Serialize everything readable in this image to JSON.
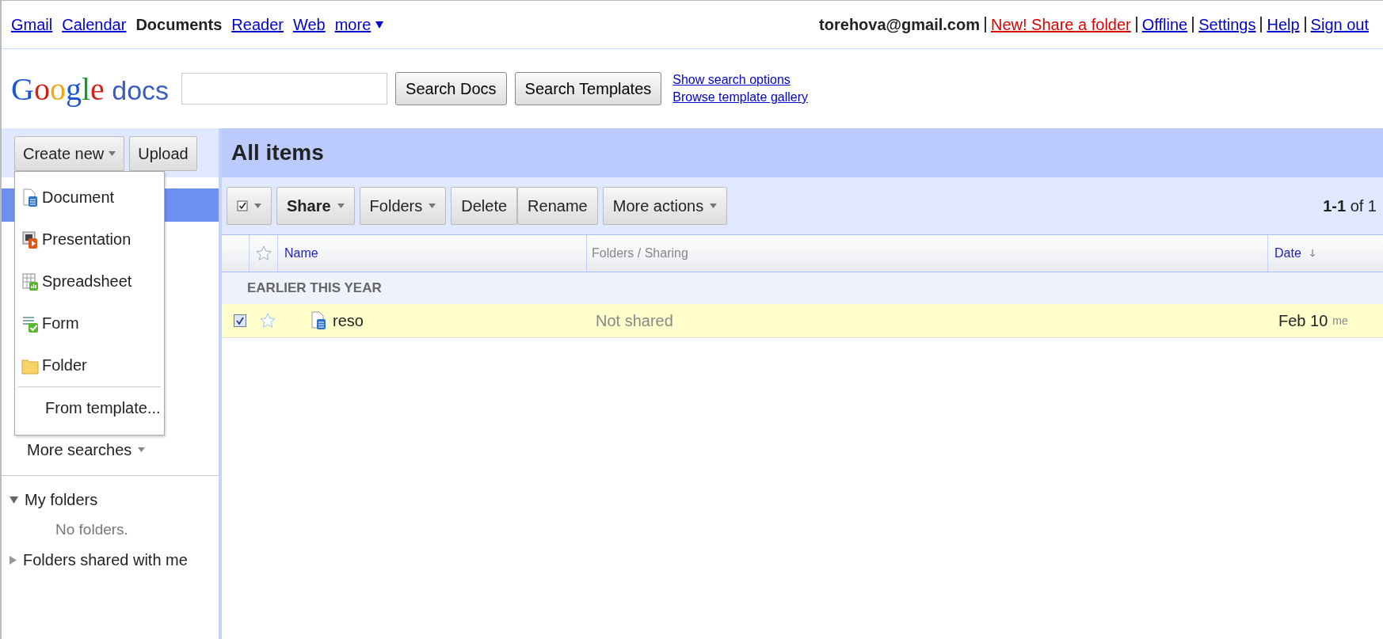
{
  "nav": {
    "links": [
      {
        "label": "Gmail",
        "selected": false
      },
      {
        "label": "Calendar",
        "selected": false
      },
      {
        "label": "Documents",
        "selected": true
      },
      {
        "label": "Reader",
        "selected": false
      },
      {
        "label": "Web",
        "selected": false
      }
    ],
    "more": "more"
  },
  "account": {
    "email": "torehova@gmail.com",
    "links": [
      {
        "label": "New! Share a folder",
        "kind": "promo"
      },
      {
        "label": "Offline",
        "kind": "link"
      },
      {
        "label": "Settings",
        "kind": "link"
      },
      {
        "label": "Help",
        "kind": "link"
      },
      {
        "label": "Sign out",
        "kind": "link"
      }
    ]
  },
  "logo": {
    "brand": "Google",
    "product": "docs"
  },
  "search": {
    "buttons": [
      "Search Docs",
      "Search Templates"
    ],
    "links": [
      "Show search options",
      "Browse template gallery"
    ]
  },
  "sidebar": {
    "create_button": "Create new",
    "upload_button": "Upload",
    "create_menu": [
      {
        "label": "Document",
        "kind": "document"
      },
      {
        "label": "Presentation",
        "kind": "presentation"
      },
      {
        "label": "Spreadsheet",
        "kind": "spreadsheet"
      },
      {
        "label": "Form",
        "kind": "form"
      },
      {
        "label": "Folder",
        "kind": "folder"
      }
    ],
    "from_template": "From template...",
    "more_searches": "More searches",
    "folders": [
      {
        "label": "My folders",
        "expanded": true,
        "empty_text": "No folders."
      },
      {
        "label": "Folders shared with me",
        "expanded": false
      }
    ]
  },
  "main": {
    "title": "All items",
    "toolbar": [
      {
        "label": "Share",
        "kind": "dropdown"
      },
      {
        "label": "Folders",
        "kind": "dropdown"
      },
      {
        "label": "Delete",
        "kind": "button"
      },
      {
        "label": "Rename",
        "kind": "button"
      },
      {
        "label": "More actions",
        "kind": "dropdown"
      }
    ],
    "pager": "**1-1** of 1",
    "columns": [
      "Name",
      "Folders / Sharing",
      "Date"
    ],
    "group": "EARLIER THIS YEAR",
    "rows": [
      {
        "name": "reso",
        "kind": "document",
        "sharing": "Not shared",
        "date": "Feb 10",
        "owner": "me",
        "checked": true,
        "starred": false,
        "selected": true
      }
    ]
  }
}
